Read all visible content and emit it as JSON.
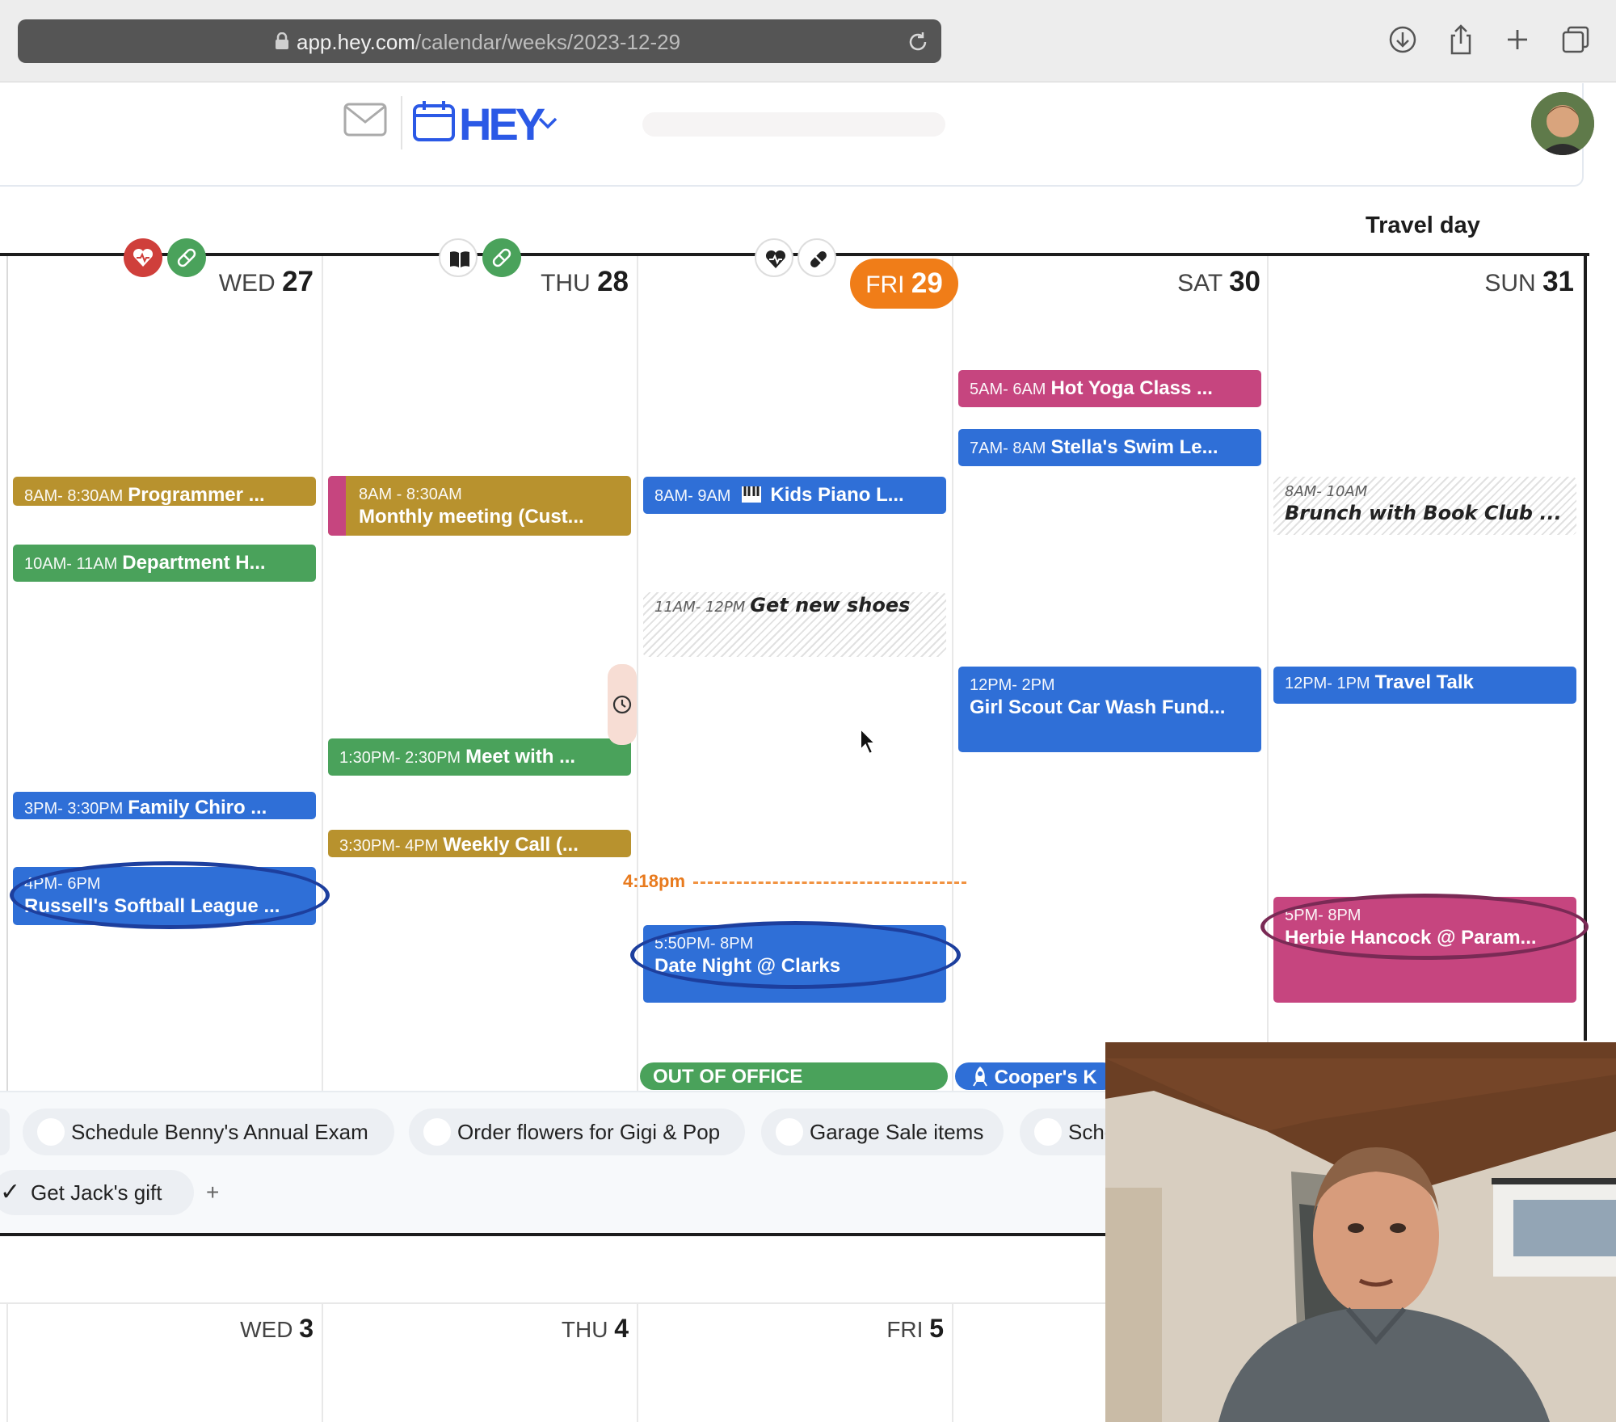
{
  "browser": {
    "url_host": "app.hey.com",
    "url_path": "/calendar/weeks/2023-12-29",
    "toolbar_icons": [
      "download-icon",
      "share-icon",
      "new-tab-icon",
      "tabs-overview-icon"
    ]
  },
  "app": {
    "logo": "HEY",
    "nav_icons": [
      "mail-icon",
      "calendar-icon",
      "chevron-down-icon"
    ]
  },
  "week": {
    "banner": "Travel day",
    "days": [
      {
        "dow": "WED",
        "num": "27",
        "badges": [
          "heart-icon",
          "pill-icon"
        ]
      },
      {
        "dow": "THU",
        "num": "28",
        "badges": [
          "book-icon",
          "pill-icon"
        ]
      },
      {
        "dow": "FRI",
        "num": "29",
        "badges": [
          "heart-icon",
          "pill-icon"
        ],
        "today": true
      },
      {
        "dow": "SAT",
        "num": "30"
      },
      {
        "dow": "SUN",
        "num": "31"
      }
    ],
    "now_time": "4:18pm",
    "events": {
      "wed": [
        {
          "time": "8AM- 8:30AM",
          "title": "Programmer ...",
          "color": "#b8922e"
        },
        {
          "time": "10AM- 11AM",
          "title": "Department H...",
          "color": "#4aa25b"
        },
        {
          "time": "3PM- 3:30PM",
          "title": "Family Chiro ...",
          "color": "#2f6fd7"
        },
        {
          "time": "4PM- 6PM",
          "title": "Russell's Softball League ...",
          "color": "#2f6fd7",
          "circled": true
        }
      ],
      "thu": [
        {
          "time": "8AM - 8:30AM",
          "title": "Monthly meeting (Cust...",
          "color": "#b8922e"
        },
        {
          "time": "1:30PM- 2:30PM",
          "title": "Meet with ...",
          "color": "#4aa25b"
        },
        {
          "time": "3:30PM- 4PM",
          "title": "Weekly Call (...",
          "color": "#b8922e"
        }
      ],
      "fri": [
        {
          "time": "8AM- 9AM",
          "title": "Kids Piano L...",
          "color": "#2f6fd7",
          "icon": "piano-icon"
        },
        {
          "time": "11AM- 12PM",
          "title": "Get new shoes",
          "style": "hatched"
        },
        {
          "time": "5:50PM- 8PM",
          "title": "Date Night @ Clarks",
          "color": "#2f6fd7",
          "circled": true
        }
      ],
      "sat": [
        {
          "time": "5AM- 6AM",
          "title": "Hot Yoga Class ...",
          "color": "#c6457f"
        },
        {
          "time": "7AM- 8AM",
          "title": "Stella's Swim Le...",
          "color": "#2f6fd7"
        },
        {
          "time": "12PM- 2PM",
          "title": "Girl Scout Car Wash Fund...",
          "color": "#2f6fd7"
        }
      ],
      "sun": [
        {
          "time": "8AM- 10AM",
          "title": "Brunch with Book Club ...",
          "style": "hatched"
        },
        {
          "time": "12PM- 1PM",
          "title": "Travel Talk",
          "color": "#2f6fd7"
        },
        {
          "time": "5PM- 8PM",
          "title": "Herbie Hancock @ Param...",
          "color": "#c6457f",
          "circled": true
        }
      ]
    },
    "allday": [
      {
        "title": "OUT OF OFFICE",
        "color": "#4aa25b"
      },
      {
        "title": "Cooper's K",
        "color": "#2f6fd7",
        "icon": "rocket-icon"
      }
    ]
  },
  "tasks": {
    "open": [
      "Schedule Benny's Annual Exam",
      "Order flowers for Gigi & Pop",
      "Garage Sale items",
      "Sche"
    ],
    "done": {
      "check": "✓",
      "label": "Get Jack's gift"
    },
    "add": "+"
  },
  "next_week": {
    "days": [
      {
        "dow": "WED",
        "num": "3"
      },
      {
        "dow": "THU",
        "num": "4"
      },
      {
        "dow": "FRI",
        "num": "5"
      }
    ]
  }
}
